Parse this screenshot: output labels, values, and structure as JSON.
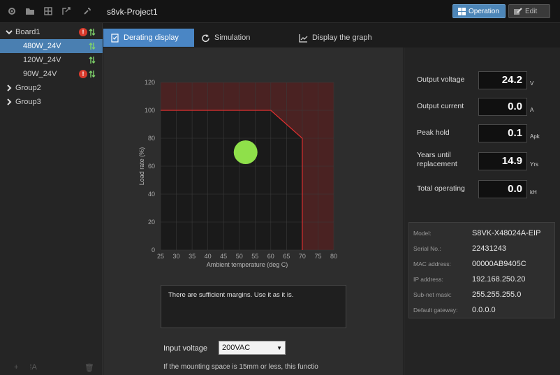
{
  "toolbar": {
    "icons": [
      "settings-icon",
      "folder-icon",
      "grid-icon",
      "export-icon",
      "wrench-icon"
    ],
    "project_title": "s8vk-Project1",
    "operation_label": "Operation",
    "edit_label": "Edit"
  },
  "sidebar": {
    "items": [
      {
        "label": "Board1",
        "status": "warn"
      },
      {
        "label": "480W_24V",
        "status": "ok"
      },
      {
        "label": "120W_24V",
        "status": "ok"
      },
      {
        "label": "90W_24V",
        "status": "warn"
      },
      {
        "label": "Group2"
      },
      {
        "label": "Group3"
      }
    ],
    "bottom": {
      "add": "+",
      "text": "⁞A",
      "delete": "🗑"
    }
  },
  "tabs": [
    {
      "label": "Derating display"
    },
    {
      "label": "Simulation"
    },
    {
      "label": "Display the graph"
    }
  ],
  "chart_data": {
    "type": "area",
    "xlabel": "Ambient temperature (deg C)",
    "ylabel": "Load rate (%)",
    "x_ticks": [
      25,
      30,
      35,
      40,
      45,
      50,
      55,
      60,
      65,
      70,
      75,
      80
    ],
    "y_ticks": [
      0,
      20,
      40,
      60,
      80,
      100,
      120
    ],
    "xlim": [
      25,
      80
    ],
    "ylim": [
      0,
      120
    ],
    "derating_curve": {
      "x": [
        25,
        60,
        70,
        70
      ],
      "y": [
        100,
        100,
        80,
        0
      ]
    },
    "operating_point": {
      "x": 52,
      "y": 70
    },
    "colors": {
      "safe": "#1a1a1a",
      "limit": "#e03030",
      "over": "#4a2222",
      "point": "#8fe04a"
    }
  },
  "message": "There are sufficient margins.  Use it as it is.",
  "input_voltage": {
    "label": "Input voltage",
    "value": "200VAC"
  },
  "note": "If the mounting space is 15mm or less, this functio",
  "measurements": [
    {
      "label": "Output voltage",
      "value": "24.2",
      "unit": "V"
    },
    {
      "label": "Output current",
      "value": "0.0",
      "unit": "A"
    },
    {
      "label": "Peak hold",
      "value": "0.1",
      "unit": "Apk"
    },
    {
      "label": "Years until\nreplacement",
      "value": "14.9",
      "unit": "Yrs"
    },
    {
      "label": "Total operating",
      "value": "0.0",
      "unit": "kH"
    }
  ],
  "device_info": [
    {
      "key": "Model:",
      "value": "S8VK-X48024A-EIP"
    },
    {
      "key": "Serial No.:",
      "value": "22431243"
    },
    {
      "key": "MAC address:",
      "value": "00000AB9405C"
    },
    {
      "key": "IP address:",
      "value": "192.168.250.20"
    },
    {
      "key": "Sub-net mask:",
      "value": "255.255.255.0"
    },
    {
      "key": "Default gateway:",
      "value": "0.0.0.0"
    }
  ]
}
